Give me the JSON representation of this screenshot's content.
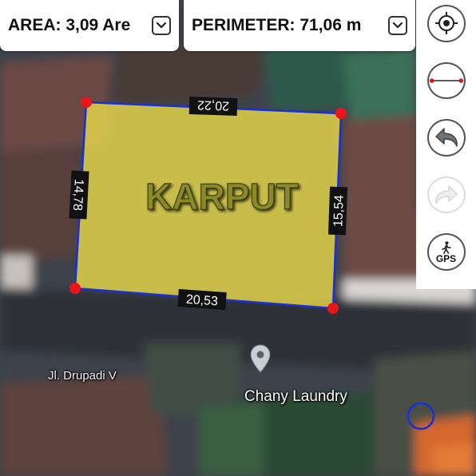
{
  "top_bar": {
    "area": {
      "text": "AREA: 3,09 Are",
      "dropdown_icon": "chevron-down-icon"
    },
    "perimeter": {
      "text": "PERIMETER: 71,06 m",
      "dropdown_icon": "chevron-down-icon"
    }
  },
  "toolbar": {
    "buttons": [
      {
        "name": "locate",
        "icon": "crosshair-icon",
        "enabled": true
      },
      {
        "name": "measure-distance",
        "icon": "distance-line-icon",
        "enabled": true
      },
      {
        "name": "undo",
        "icon": "undo-icon",
        "enabled": true
      },
      {
        "name": "redo",
        "icon": "redo-icon",
        "enabled": false
      },
      {
        "name": "gps",
        "icon": "walking-person-icon",
        "label": "GPS",
        "enabled": true
      }
    ]
  },
  "plot": {
    "label": "KARPUT",
    "fill_color": "#e8d84a",
    "edge_color": "#1a2fd8",
    "vertex_color": "#e8161b",
    "edges": [
      {
        "side": "top",
        "length": "20,22"
      },
      {
        "side": "right",
        "length": "15,54"
      },
      {
        "side": "bottom",
        "length": "20,53"
      },
      {
        "side": "left",
        "length": "14,78"
      }
    ]
  },
  "map": {
    "street_label": "Jl. Drupadi V",
    "poi": {
      "name": "Chany Laundry",
      "icon": "map-pin-icon"
    },
    "current_location_icon": "location-circle-icon"
  }
}
